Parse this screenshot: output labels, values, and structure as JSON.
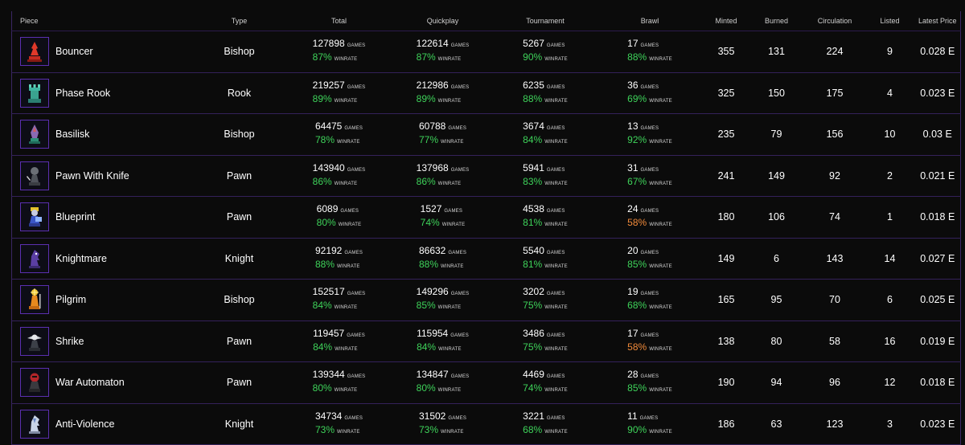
{
  "columns": [
    "Piece",
    "Type",
    "Total",
    "Quickplay",
    "Tournament",
    "Brawl",
    "Minted",
    "Burned",
    "Circulation",
    "Listed",
    "Latest Price"
  ],
  "units": {
    "games": "GAMES",
    "winrate": "WINRATE"
  },
  "colors": {
    "background": "#0b0b0b",
    "border": "#34215a",
    "accent": "#5b2fb0",
    "win_green": "#3ed35a",
    "win_orange": "#f08a3a"
  },
  "rows": [
    {
      "name": "Bouncer",
      "icon": "bouncer-bishop-icon",
      "type": "Bishop",
      "total": {
        "games": "127898",
        "winrate": "87%"
      },
      "quickplay": {
        "games": "122614",
        "winrate": "87%"
      },
      "tournament": {
        "games": "5267",
        "winrate": "90%"
      },
      "brawl": {
        "games": "17",
        "winrate": "88%",
        "color": "green"
      },
      "minted": "355",
      "burned": "131",
      "circulation": "224",
      "listed": "9",
      "price": "0.028 E"
    },
    {
      "name": "Phase Rook",
      "icon": "phase-rook-icon",
      "type": "Rook",
      "total": {
        "games": "219257",
        "winrate": "89%"
      },
      "quickplay": {
        "games": "212986",
        "winrate": "89%"
      },
      "tournament": {
        "games": "6235",
        "winrate": "88%"
      },
      "brawl": {
        "games": "36",
        "winrate": "69%",
        "color": "green"
      },
      "minted": "325",
      "burned": "150",
      "circulation": "175",
      "listed": "4",
      "price": "0.023 E"
    },
    {
      "name": "Basilisk",
      "icon": "basilisk-bishop-icon",
      "type": "Bishop",
      "total": {
        "games": "64475",
        "winrate": "78%"
      },
      "quickplay": {
        "games": "60788",
        "winrate": "77%"
      },
      "tournament": {
        "games": "3674",
        "winrate": "84%"
      },
      "brawl": {
        "games": "13",
        "winrate": "92%",
        "color": "green"
      },
      "minted": "235",
      "burned": "79",
      "circulation": "156",
      "listed": "10",
      "price": "0.03 E"
    },
    {
      "name": "Pawn With Knife",
      "icon": "pawn-with-knife-icon",
      "type": "Pawn",
      "total": {
        "games": "143940",
        "winrate": "86%"
      },
      "quickplay": {
        "games": "137968",
        "winrate": "86%"
      },
      "tournament": {
        "games": "5941",
        "winrate": "83%"
      },
      "brawl": {
        "games": "31",
        "winrate": "67%",
        "color": "green"
      },
      "minted": "241",
      "burned": "149",
      "circulation": "92",
      "listed": "2",
      "price": "0.021 E"
    },
    {
      "name": "Blueprint",
      "icon": "blueprint-pawn-icon",
      "type": "Pawn",
      "total": {
        "games": "6089",
        "winrate": "80%"
      },
      "quickplay": {
        "games": "1527",
        "winrate": "74%"
      },
      "tournament": {
        "games": "4538",
        "winrate": "81%"
      },
      "brawl": {
        "games": "24",
        "winrate": "58%",
        "color": "orange"
      },
      "minted": "180",
      "burned": "106",
      "circulation": "74",
      "listed": "1",
      "price": "0.018 E"
    },
    {
      "name": "Knightmare",
      "icon": "knightmare-knight-icon",
      "type": "Knight",
      "total": {
        "games": "92192",
        "winrate": "88%"
      },
      "quickplay": {
        "games": "86632",
        "winrate": "88%"
      },
      "tournament": {
        "games": "5540",
        "winrate": "81%"
      },
      "brawl": {
        "games": "20",
        "winrate": "85%",
        "color": "green"
      },
      "minted": "149",
      "burned": "6",
      "circulation": "143",
      "listed": "14",
      "price": "0.027 E"
    },
    {
      "name": "Pilgrim",
      "icon": "pilgrim-bishop-icon",
      "type": "Bishop",
      "total": {
        "games": "152517",
        "winrate": "84%"
      },
      "quickplay": {
        "games": "149296",
        "winrate": "85%"
      },
      "tournament": {
        "games": "3202",
        "winrate": "75%"
      },
      "brawl": {
        "games": "19",
        "winrate": "68%",
        "color": "green"
      },
      "minted": "165",
      "burned": "95",
      "circulation": "70",
      "listed": "6",
      "price": "0.025 E"
    },
    {
      "name": "Shrike",
      "icon": "shrike-pawn-icon",
      "type": "Pawn",
      "total": {
        "games": "119457",
        "winrate": "84%"
      },
      "quickplay": {
        "games": "115954",
        "winrate": "84%"
      },
      "tournament": {
        "games": "3486",
        "winrate": "75%"
      },
      "brawl": {
        "games": "17",
        "winrate": "58%",
        "color": "orange"
      },
      "minted": "138",
      "burned": "80",
      "circulation": "58",
      "listed": "16",
      "price": "0.019 E"
    },
    {
      "name": "War Automaton",
      "icon": "war-automaton-pawn-icon",
      "type": "Pawn",
      "total": {
        "games": "139344",
        "winrate": "80%"
      },
      "quickplay": {
        "games": "134847",
        "winrate": "80%"
      },
      "tournament": {
        "games": "4469",
        "winrate": "74%"
      },
      "brawl": {
        "games": "28",
        "winrate": "85%",
        "color": "green"
      },
      "minted": "190",
      "burned": "94",
      "circulation": "96",
      "listed": "12",
      "price": "0.018 E"
    },
    {
      "name": "Anti-Violence",
      "icon": "anti-violence-knight-icon",
      "type": "Knight",
      "total": {
        "games": "34734",
        "winrate": "73%"
      },
      "quickplay": {
        "games": "31502",
        "winrate": "73%"
      },
      "tournament": {
        "games": "3221",
        "winrate": "68%"
      },
      "brawl": {
        "games": "11",
        "winrate": "90%",
        "color": "green"
      },
      "minted": "186",
      "burned": "63",
      "circulation": "123",
      "listed": "3",
      "price": "0.023 E"
    }
  ]
}
